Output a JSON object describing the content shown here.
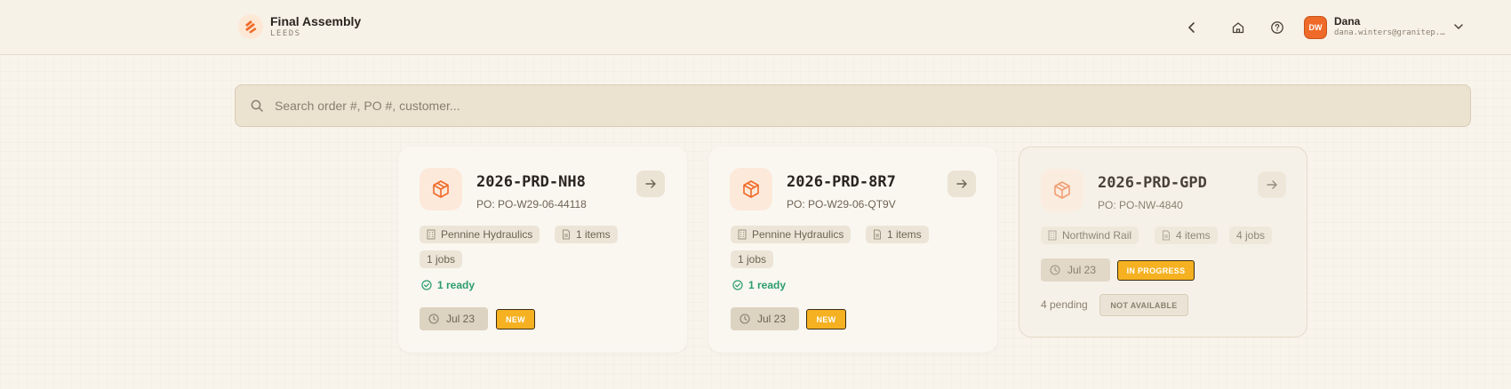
{
  "header": {
    "title": "Final Assembly",
    "subtitle": "LEEDS",
    "user": {
      "initials": "DW",
      "name": "Dana",
      "email": "dana.winters@granitep..."
    }
  },
  "search": {
    "placeholder": "Search order #, PO #, customer...",
    "value": ""
  },
  "icons": {
    "brand": "flame-logo-icon",
    "back": "chevron-left-icon",
    "home": "home-icon",
    "help": "help-circle-icon",
    "user_menu": "chevron-down-icon",
    "search": "search-icon",
    "order": "package-icon",
    "open": "arrow-right-icon",
    "customer": "building-icon",
    "items": "document-icon",
    "ready": "check-circle-icon",
    "date": "clock-icon"
  },
  "colors": {
    "accent": "#ef6a28",
    "status_new": "#f5b121",
    "ready": "#2b9d6c"
  },
  "orders": [
    {
      "order_no": "2026-PRD-NH8",
      "po": "PO: PO-W29-06-44118",
      "customer": "Pennine Hydraulics",
      "items": "1 items",
      "jobs": "1 jobs",
      "ready": "1 ready",
      "date": "Jul 23",
      "status": "NEW"
    },
    {
      "order_no": "2026-PRD-8R7",
      "po": "PO: PO-W29-06-QT9V",
      "customer": "Pennine Hydraulics",
      "items": "1 items",
      "jobs": "1 jobs",
      "ready": "1 ready",
      "date": "Jul 23",
      "status": "NEW"
    },
    {
      "order_no": "2026-PRD-GPD",
      "po": "PO: PO-NW-4840",
      "customer": "Northwind Rail",
      "items": "4 items",
      "jobs": "4 jobs",
      "date": "Jul 23",
      "status": "IN PROGRESS",
      "pending": "4 pending",
      "availability": "NOT AVAILABLE"
    }
  ]
}
